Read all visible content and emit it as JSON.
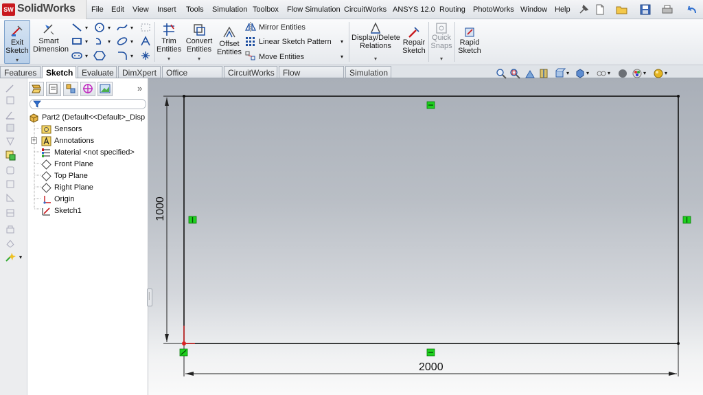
{
  "app": {
    "name": "SolidWorks",
    "logo_text": "SW"
  },
  "menu": [
    "File",
    "Edit",
    "View",
    "Insert",
    "Tools",
    "Simulation",
    "Toolbox",
    "Flow Simulation",
    "CircuitWorks",
    "ANSYS 12.0",
    "Routing",
    "PhotoWorks",
    "Window",
    "Help"
  ],
  "ribbon": {
    "exit_sketch": "Exit Sketch",
    "smart_dimension": "Smart Dimension",
    "trim_entities": "Trim Entities",
    "convert_entities": "Convert Entities",
    "offset_entities": "Offset Entities",
    "mirror_entities": "Mirror Entities",
    "linear_sketch_pattern": "Linear Sketch Pattern",
    "move_entities": "Move Entities",
    "display_delete_relations": "Display/Delete Relations",
    "repair_sketch": "Repair Sketch",
    "quick_snaps": "Quick Snaps",
    "rapid_sketch": "Rapid Sketch"
  },
  "tabs": [
    {
      "label": "Features",
      "active": false
    },
    {
      "label": "Sketch",
      "active": true
    },
    {
      "label": "Evaluate",
      "active": false
    },
    {
      "label": "DimXpert",
      "active": false
    },
    {
      "label": "Office Products",
      "active": false
    },
    {
      "label": "CircuitWorks",
      "active": false
    },
    {
      "label": "Flow Simulation",
      "active": false
    },
    {
      "label": "Simulation",
      "active": false
    }
  ],
  "tree": {
    "root": "Part2  (Default<<Default>_Disp",
    "items": [
      {
        "label": "Sensors",
        "icon": "sensors-icon"
      },
      {
        "label": "Annotations",
        "icon": "annotations-icon"
      },
      {
        "label": "Material <not specified>",
        "icon": "material-icon"
      },
      {
        "label": "Front Plane",
        "icon": "plane-icon"
      },
      {
        "label": "Top Plane",
        "icon": "plane-icon"
      },
      {
        "label": "Right Plane",
        "icon": "plane-icon"
      },
      {
        "label": "Origin",
        "icon": "origin-icon"
      },
      {
        "label": "Sketch1",
        "icon": "sketch-icon"
      }
    ]
  },
  "sketch": {
    "width_dimension": "2000",
    "height_dimension": "1000"
  },
  "colors": {
    "relation_marker": "#1fd11f",
    "accent": "#c8191e",
    "canvas_top": "#a9afb8",
    "canvas_bottom": "#fafafa"
  }
}
